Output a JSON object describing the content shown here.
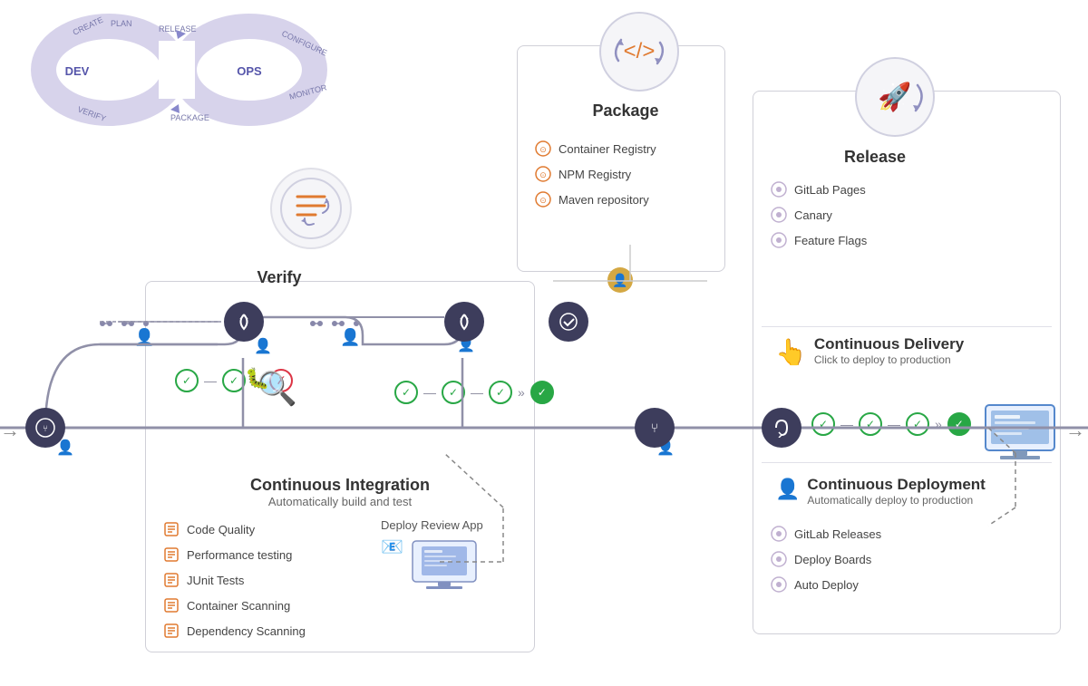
{
  "infinity": {
    "dev_label": "DEV",
    "ops_label": "OPS",
    "stages": [
      "CREATE",
      "PLAN",
      "RELEASE",
      "CONFIGURE",
      "MONITOR",
      "PACKAGE",
      "VERIFY"
    ]
  },
  "verify": {
    "title": "Verify",
    "icon": "≡›"
  },
  "package": {
    "title": "Package",
    "features": [
      "Container Registry",
      "NPM Registry",
      "Maven repository"
    ]
  },
  "release": {
    "title": "Release",
    "features_top": [
      "GitLab Pages",
      "Canary",
      "Feature Flags"
    ],
    "continuous_delivery": {
      "title": "Continuous Delivery",
      "subtitle": "Click to deploy to production"
    },
    "continuous_deployment": {
      "title": "Continuous Deployment",
      "subtitle": "Automatically deploy to production"
    },
    "features_bottom": [
      "GitLab Releases",
      "Deploy Boards",
      "Auto Deploy"
    ]
  },
  "ci": {
    "title": "Continuous Integration",
    "subtitle": "Automatically build and test",
    "features": [
      "Code Quality",
      "Performance testing",
      "JUnit Tests",
      "Container Scanning",
      "Dependency Scanning"
    ],
    "deploy_review": "Deploy Review App"
  }
}
